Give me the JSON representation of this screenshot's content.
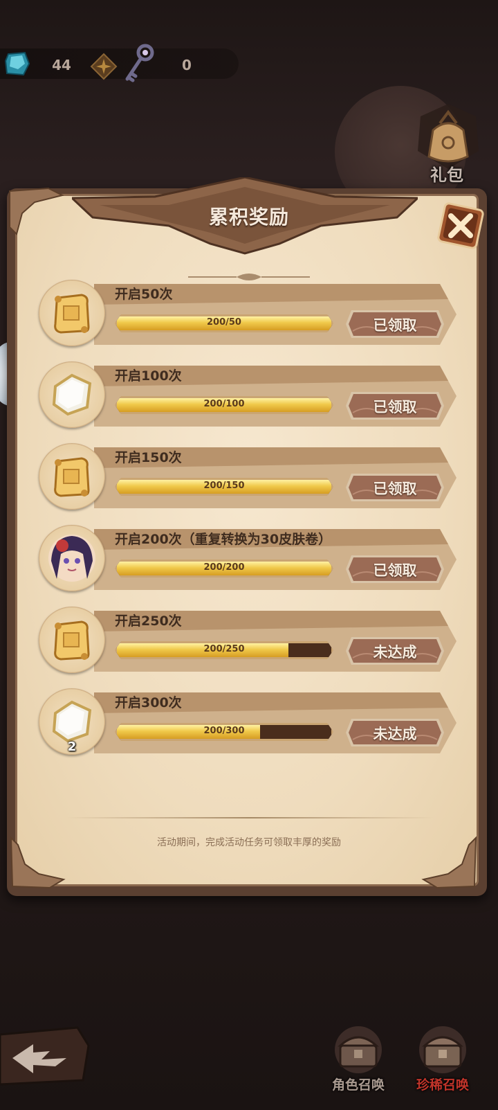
{
  "currencies": {
    "gem_icon": "gem-icon",
    "gem_count": "44",
    "compass_icon": "compass-icon",
    "key_icon": "key-icon",
    "key_count": "0"
  },
  "gift": {
    "icon": "gift-bag-icon",
    "label": "礼包"
  },
  "panel": {
    "title": "累积奖励",
    "footer_note": "活动期间，完成活动任务可领取丰厚的奖励"
  },
  "rewards": [
    {
      "title": "开启50次",
      "icon": "scroll-icon",
      "progress_text": "200/50",
      "progress": 1.0,
      "status": "已领取"
    },
    {
      "title": "开启100次",
      "icon": "stone-icon",
      "progress_text": "200/100",
      "progress": 1.0,
      "status": "已领取"
    },
    {
      "title": "开启150次",
      "icon": "scroll-icon",
      "progress_text": "200/150",
      "progress": 1.0,
      "status": "已领取"
    },
    {
      "title": "开启200次（重复转换为30皮肤卷）",
      "icon": "character-portrait-icon",
      "progress_text": "200/200",
      "progress": 1.0,
      "status": "已领取"
    },
    {
      "title": "开启250次",
      "icon": "scroll-icon",
      "progress_text": "200/250",
      "progress": 0.8,
      "status": "未达成"
    },
    {
      "title": "开启300次",
      "icon": "stone-icon",
      "progress_text": "200/300",
      "progress": 0.667,
      "status": "未达成",
      "count": "2"
    }
  ],
  "bottom_nav": {
    "back_icon": "back-arrow-icon",
    "character_summon": "角色召唤",
    "rare_summon": "珍稀召唤"
  },
  "colors": {
    "claimed_button": "#9b6b55",
    "unreached_button": "#9b6b55",
    "progress_fill": "#f0c94a",
    "rare_summon_label": "#c0342a",
    "character_summon_label": "#a99a90"
  }
}
